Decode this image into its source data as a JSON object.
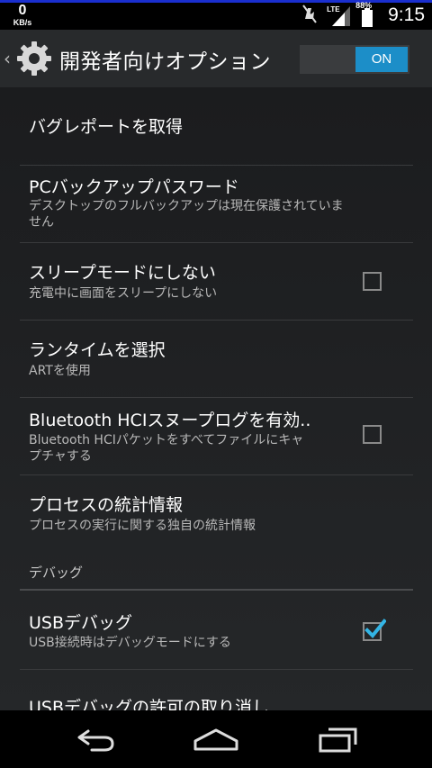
{
  "status_bar": {
    "net_speed_value": "0",
    "net_speed_unit": "KB/s",
    "network_type": "LTE",
    "battery_percent": "88%",
    "time": "9:15",
    "icons": [
      "muted-icon",
      "signal-icon",
      "battery-icon"
    ]
  },
  "action_bar": {
    "title": "開発者向けオプション",
    "switch_label": "ON",
    "switch_on": true,
    "icon": "gear-icon"
  },
  "settings": {
    "bug_report": {
      "title": "バグレポートを取得"
    },
    "pc_backup_password": {
      "title": "PCバックアップパスワード",
      "summary_line1": "デスクトップのフルバックアップは現在保護されていま",
      "summary_line2": "せん"
    },
    "stay_awake": {
      "title": "スリープモードにしない",
      "summary": "充電中に画面をスリープにしない",
      "checked": false
    },
    "runtime": {
      "title": "ランタイムを選択",
      "summary": "ARTを使用"
    },
    "bt_hci_log": {
      "title": "Bluetooth HCIスヌープログを有効..",
      "summary_line1": "Bluetooth HCIパケットをすべてファイルにキャ",
      "summary_line2": "プチャする",
      "checked": false
    },
    "process_stats": {
      "title": "プロセスの統計情報",
      "summary": "プロセスの実行に関する独自の統計情報"
    },
    "debug_category": "デバッグ",
    "usb_debugging": {
      "title": "USBデバッグ",
      "summary": "USB接続時はデバッグモードにする",
      "checked": true
    },
    "revoke_usb": {
      "title": "USBデバッグの許可の取り消し"
    }
  },
  "nav_bar": {
    "buttons": [
      "back-icon",
      "home-icon",
      "recents-icon"
    ]
  },
  "colors": {
    "accent": "#1c8ec8",
    "checkmark": "#33b5e5",
    "action_bar_bg": "#282a2c",
    "status_line": "#1a2fcf"
  }
}
